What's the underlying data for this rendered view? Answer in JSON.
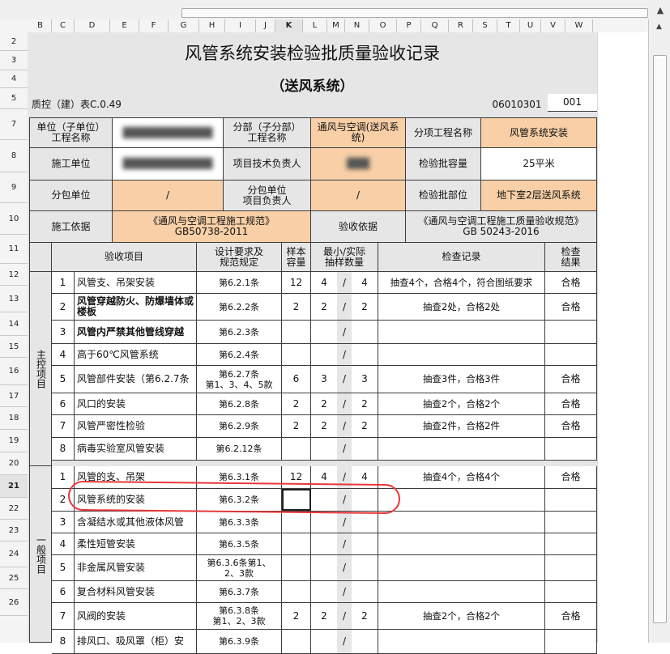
{
  "columns": [
    "B",
    "C",
    "D",
    "E",
    "F",
    "G",
    "H",
    "I",
    "J",
    "K",
    "L",
    "M",
    "N",
    "O",
    "P",
    "Q",
    "R",
    "S",
    "T",
    "U",
    "V",
    "W"
  ],
  "selected_column": "K",
  "rows": [
    "2",
    "3",
    "4",
    "5",
    "7",
    "8",
    "9",
    "10",
    "11",
    "12",
    "13",
    "14",
    "15",
    "16",
    "17",
    "18",
    "19",
    "20",
    "21",
    "22",
    "23",
    "24",
    "25",
    "26"
  ],
  "selected_row": "21",
  "form": {
    "title": "风管系统安装检验批质量验收记录",
    "subtitle": "（送风系统）",
    "form_code": "质控（建）表C.0.49",
    "doc_number": "06010301",
    "serial": "001"
  },
  "header": {
    "unit_label": "单位（子单位）\n工程名称",
    "unit_value": "████████████",
    "subdivision_label": "分部（子分部）\n工程名称",
    "subdivision_value": "通风与空调(送风系统)",
    "subitem_label": "分项工程名称",
    "subitem_value": "风管系统安装",
    "contractor_label": "施工单位",
    "contractor_value": "████████████",
    "tech_lead_label": "项目技术负责人",
    "tech_lead_value": "███",
    "batch_capacity_label": "检验批容量",
    "batch_capacity_value": "25平米",
    "subcontractor_label": "分包单位",
    "subcontractor_value": "/",
    "sub_lead_label": "分包单位\n项目负责人",
    "sub_lead_value": "/",
    "batch_location_label": "检验批部位",
    "batch_location_value": "地下室2层送风系统",
    "basis_label": "施工依据",
    "basis_value": "《通风与空调工程施工规范》GB50738-2011",
    "acceptance_basis_label": "验收依据",
    "acceptance_basis_value": "《通风与空调工程施工质量验收规范》GB 50243-2016"
  },
  "table_headers": {
    "item": "验收项目",
    "design": "设计要求及\n规范规定",
    "sample": "样本\n容量",
    "min_actual": "最小/实际\n抽样数量",
    "record": "检查记录",
    "result": "检查\n结果"
  },
  "main_group_label": "主控项目",
  "general_group_label": "一般项目",
  "main_items": [
    {
      "no": "1",
      "name": "风管支、吊架安装",
      "clause": "第6.2.1条",
      "sample": "12",
      "min": "4",
      "sep": "/",
      "actual": "4",
      "record": "抽查4个，合格4个，符合图纸要求",
      "result": "合格",
      "bold": false
    },
    {
      "no": "2",
      "name": "风管穿越防火、防爆墙体或楼板",
      "clause": "第6.2.2条",
      "sample": "2",
      "min": "2",
      "sep": "/",
      "actual": "2",
      "record": "抽查2处，合格2处",
      "result": "合格",
      "bold": true
    },
    {
      "no": "3",
      "name": "风管内严禁其他管线穿越",
      "clause": "第6.2.3条",
      "sample": "",
      "min": "",
      "sep": "/",
      "actual": "",
      "record": "",
      "result": "",
      "bold": true
    },
    {
      "no": "4",
      "name": "高于60℃风管系统",
      "clause": "第6.2.4条",
      "sample": "",
      "min": "",
      "sep": "/",
      "actual": "",
      "record": "",
      "result": "",
      "bold": false
    },
    {
      "no": "5",
      "name": "风管部件安装（第6.2.7条",
      "clause": "第6.2.7条\n第1、3、4、5款",
      "sample": "6",
      "min": "3",
      "sep": "/",
      "actual": "3",
      "record": "抽查3件，合格3件",
      "result": "合格",
      "bold": false
    },
    {
      "no": "6",
      "name": "风口的安装",
      "clause": "第6.2.8条",
      "sample": "2",
      "min": "2",
      "sep": "/",
      "actual": "2",
      "record": "抽查2个，合格2个",
      "result": "合格",
      "bold": false
    },
    {
      "no": "7",
      "name": "风管严密性检验",
      "clause": "第6.2.9条",
      "sample": "2",
      "min": "2",
      "sep": "/",
      "actual": "2",
      "record": "抽查2件，合格2件",
      "result": "合格",
      "bold": false
    },
    {
      "no": "8",
      "name": "病毒实验室风管安装",
      "clause": "第6.2.12条",
      "sample": "",
      "min": "",
      "sep": "/",
      "actual": "",
      "record": "",
      "result": "",
      "bold": false
    }
  ],
  "general_items": [
    {
      "no": "1",
      "name": "风管的支、吊架",
      "clause": "第6.3.1条",
      "sample": "12",
      "min": "4",
      "sep": "/",
      "actual": "4",
      "record": "抽查4个，合格4个",
      "result": "合格",
      "bold": false
    },
    {
      "no": "2",
      "name": "风管系统的安装",
      "clause": "第6.3.2条",
      "sample": "",
      "min": "",
      "sep": "/",
      "actual": "",
      "record": "",
      "result": "",
      "bold": false
    },
    {
      "no": "3",
      "name": "含凝结水或其他液体风管",
      "clause": "第6.3.3条",
      "sample": "",
      "min": "",
      "sep": "/",
      "actual": "",
      "record": "",
      "result": "",
      "bold": false
    },
    {
      "no": "4",
      "name": "柔性短管安装",
      "clause": "第6.3.5条",
      "sample": "",
      "min": "",
      "sep": "/",
      "actual": "",
      "record": "",
      "result": "",
      "bold": false
    },
    {
      "no": "5",
      "name": "非金属风管安装",
      "clause": "第6.3.6条第1、\n2、3款",
      "sample": "",
      "min": "",
      "sep": "/",
      "actual": "",
      "record": "",
      "result": "",
      "bold": false
    },
    {
      "no": "6",
      "name": "复合材料风管安装",
      "clause": "第6.3.7条",
      "sample": "",
      "min": "",
      "sep": "/",
      "actual": "",
      "record": "",
      "result": "",
      "bold": false
    },
    {
      "no": "7",
      "name": "风阀的安装",
      "clause": "第6.3.8条\n第1、2、3款",
      "sample": "2",
      "min": "2",
      "sep": "/",
      "actual": "2",
      "record": "抽查2个，合格2个",
      "result": "合格",
      "bold": false
    },
    {
      "no": "8",
      "name": "排风口、吸风罩（柜）安",
      "clause": "第6.3.9条",
      "sample": "",
      "min": "",
      "sep": "/",
      "actual": "",
      "record": "",
      "result": "",
      "bold": false
    }
  ]
}
